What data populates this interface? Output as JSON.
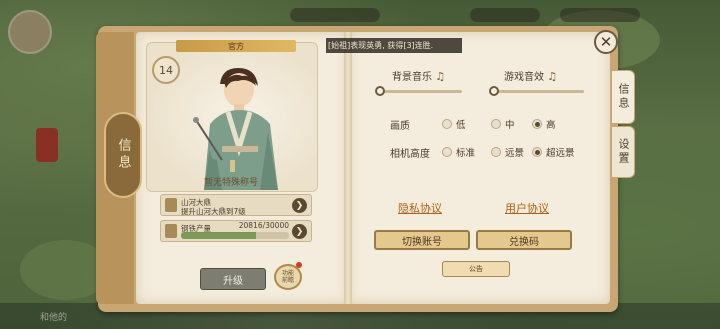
{
  "banner": {
    "text": "[始祖]表现英勇, 获得[3]连胜."
  },
  "left_page": {
    "side_tab_label": "信息",
    "official_label": "官方",
    "level": "14",
    "title_text": "暂无特殊称号",
    "item1": {
      "line1": "山河大鼎",
      "line2": "提升山河大鼎到7级"
    },
    "item2": {
      "label": "钢铁产量",
      "progress_text": "20816/30000",
      "progress_fraction": 0.694
    },
    "upgrade_label": "升级",
    "func_label_1": "功能",
    "func_label_2": "前瞻"
  },
  "right_tabs": {
    "info": "信息",
    "settings": "设置"
  },
  "settings": {
    "bg_music_label": "背景音乐",
    "sfx_label": "游戏音效",
    "music_icon": "music-note-icon",
    "bg_music_level": 0.0,
    "sfx_level": 0.0,
    "quality_label": "画质",
    "quality_options": [
      "低",
      "中",
      "高"
    ],
    "quality_selected": "高",
    "camera_label": "相机高度",
    "camera_options": [
      "标准",
      "远景",
      "超远景"
    ],
    "camera_selected": "超远景",
    "privacy_link": "隐私协议",
    "user_link": "用户协议",
    "switch_account_button": "切换账号",
    "redeem_button": "兑换码",
    "notice_button": "公告"
  },
  "bottom": {
    "hint": "和他的"
  },
  "colors": {
    "accent": "#b06018",
    "paper": "#f4ecdc",
    "cover": "#c9a774"
  }
}
